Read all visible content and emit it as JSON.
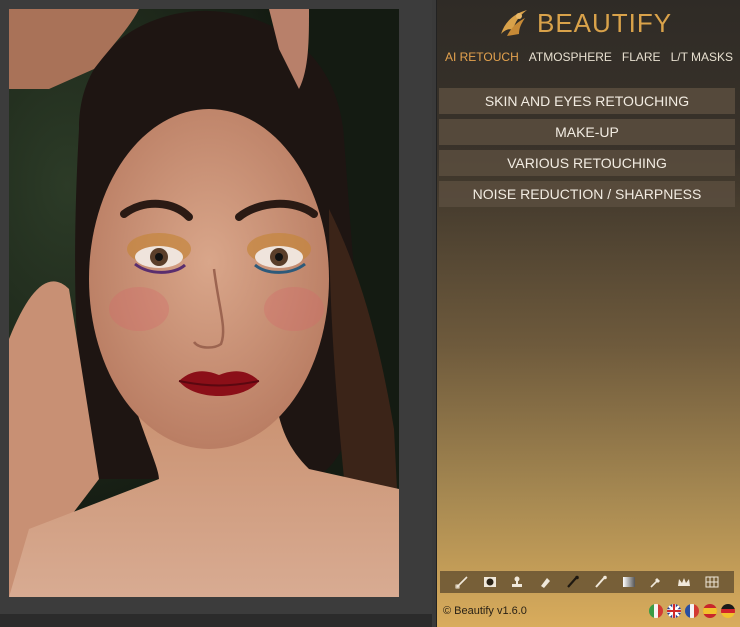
{
  "app": {
    "name": "BEAUTIFY",
    "brand_color": "#d9a24a",
    "accent_color": "#e4a24e"
  },
  "tabs": [
    {
      "label": "AI RETOUCH",
      "active": true
    },
    {
      "label": "ATMOSPHERE",
      "active": false
    },
    {
      "label": "FLARE",
      "active": false
    },
    {
      "label": "L/T MASKS",
      "active": false
    }
  ],
  "menu": [
    {
      "label": "SKIN AND EYES RETOUCHING"
    },
    {
      "label": "MAKE-UP"
    },
    {
      "label": "VARIOUS RETOUCHING"
    },
    {
      "label": "NOISE REDUCTION / SHARPNESS"
    }
  ],
  "toolbar": {
    "tools": [
      "eyedropper-brush-icon",
      "vignette-mask-icon",
      "stamp-icon",
      "eraser-icon",
      "brush-icon",
      "soft-brush-icon",
      "gradient-icon",
      "dropper-icon",
      "crown-icon",
      "grid-icon"
    ]
  },
  "footer": {
    "version": "© Beautify v1.6.0",
    "languages": [
      "italian-flag-icon",
      "uk-flag-icon",
      "french-flag-icon",
      "spanish-flag-icon",
      "german-flag-icon"
    ]
  }
}
